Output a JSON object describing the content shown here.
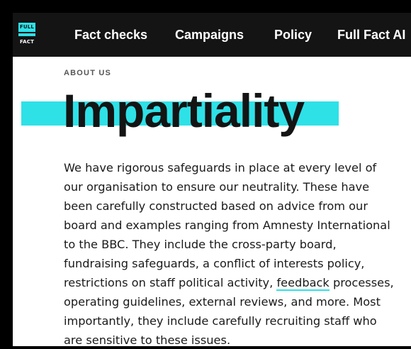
{
  "logo": {
    "top_text": "FULL",
    "bottom_text": "FACT"
  },
  "nav": {
    "items": [
      "Fact checks",
      "Campaigns",
      "Policy",
      "Full Fact AI"
    ]
  },
  "page": {
    "eyebrow": "ABOUT US",
    "title": "Impartiality",
    "body_lines": [
      "We have rigorous safeguards in place at every level of",
      "our organisation to ensure our neutrality. These have",
      "been carefully constructed based on advice from our",
      "board and examples ranging from Amnesty International",
      "to the BBC. They include the cross-party board,",
      "fundraising safeguards, a conflict of interests policy,"
    ],
    "line7_before": "restrictions on staff political activity, ",
    "line7_link": "feedback",
    "line7_after": " processes,",
    "body_lines_end": [
      "operating guidelines, external reviews, and more. Most",
      "importantly, they include carefully recruiting staff who",
      "are sensitive to these issues."
    ]
  },
  "colors": {
    "accent": "#2ee1e7",
    "nav_bg": "#141414",
    "text": "#1a1a1a"
  }
}
